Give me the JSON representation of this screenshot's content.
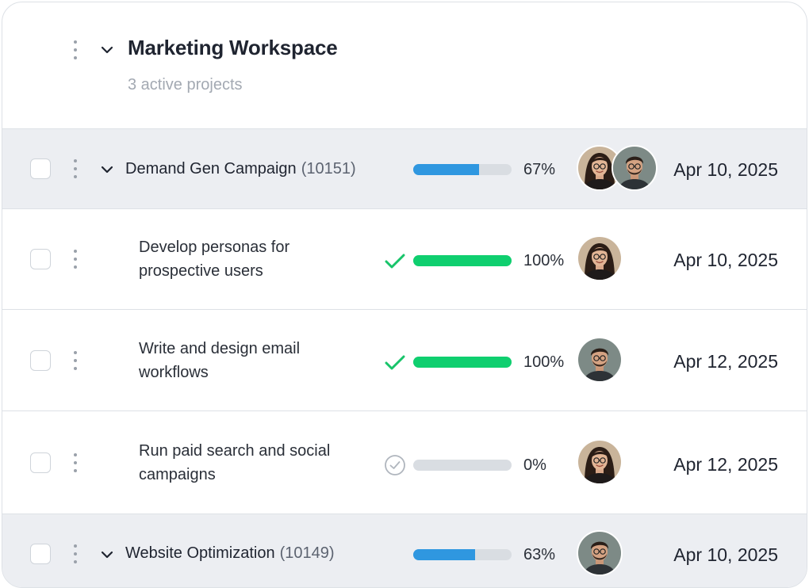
{
  "workspace": {
    "title": "Marketing Workspace",
    "subtitle": "3 active projects"
  },
  "colors": {
    "progress_partial": "#2f97e0",
    "progress_complete": "#0fcf6f",
    "progress_track": "#d9dde2",
    "check": "#18c46a",
    "pending": "#b0b6be"
  },
  "rows": [
    {
      "type": "group",
      "name": "Demand Gen Campaign",
      "id": "(10151)",
      "progress": 67,
      "progress_label": "67%",
      "assignees": [
        "woman-avatar",
        "man-avatar"
      ],
      "date": "Apr 10, 2025"
    },
    {
      "type": "task",
      "name": "Develop personas for prospective users",
      "status_icon": "check-icon",
      "progress": 100,
      "progress_label": "100%",
      "assignees": [
        "woman-avatar"
      ],
      "date": "Apr 10, 2025"
    },
    {
      "type": "task",
      "name": "Write and design email workflows",
      "status_icon": "check-icon",
      "progress": 100,
      "progress_label": "100%",
      "assignees": [
        "man-avatar"
      ],
      "date": "Apr 12, 2025"
    },
    {
      "type": "task",
      "name": "Run paid search and social campaigns",
      "status_icon": "circle-check-icon",
      "progress": 0,
      "progress_label": "0%",
      "assignees": [
        "woman-avatar"
      ],
      "date": "Apr 12, 2025"
    },
    {
      "type": "group",
      "name": "Website Optimization",
      "id": "(10149)",
      "progress": 63,
      "progress_label": "63%",
      "assignees": [
        "man-avatar"
      ],
      "date": "Apr 10, 2025"
    }
  ]
}
